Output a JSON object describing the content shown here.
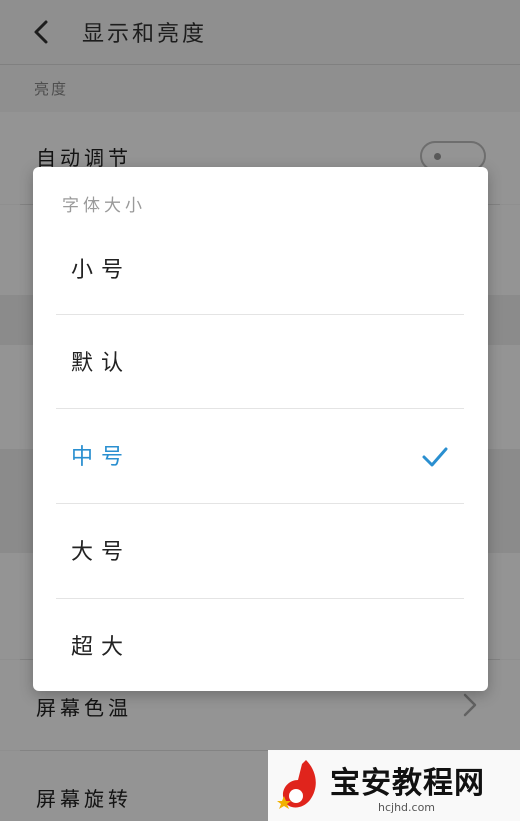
{
  "header": {
    "title": "显示和亮度"
  },
  "section": {
    "label": "亮度"
  },
  "rows": {
    "auto_adjust": {
      "label": "自动调节",
      "toggle_on": false
    },
    "screen_color_temp": {
      "label": "屏幕色温"
    },
    "screen_rotation": {
      "label": "屏幕旋转"
    }
  },
  "dialog": {
    "title": "字体大小",
    "options": [
      {
        "label": "小号",
        "selected": false
      },
      {
        "label": "默认",
        "selected": false
      },
      {
        "label": "中号",
        "selected": true
      },
      {
        "label": "大号",
        "selected": false
      },
      {
        "label": "超大",
        "selected": false
      }
    ],
    "check_icon": "checkmark-icon"
  },
  "colors": {
    "accent": "#2a8fd0",
    "overlay": "rgba(0,0,0,0.42)",
    "watermark_red": "#e0241c"
  },
  "watermark": {
    "title": "宝安教程网",
    "url": "hcjhd.com"
  }
}
